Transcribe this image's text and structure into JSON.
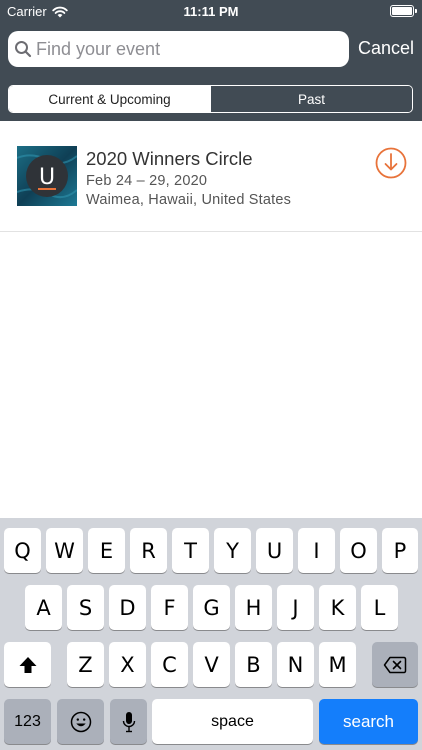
{
  "status_bar": {
    "carrier": "Carrier",
    "time": "11:11 PM"
  },
  "search": {
    "placeholder": "Find your event",
    "value": "",
    "cancel_label": "Cancel"
  },
  "segments": [
    {
      "label": "Current & Upcoming",
      "selected": true
    },
    {
      "label": "Past",
      "selected": false
    }
  ],
  "events": [
    {
      "title": "2020 Winners Circle",
      "dates": "Feb 24 – 29, 2020",
      "location": "Waimea, Hawaii, United States",
      "logo_letter": "U",
      "action_icon": "download-icon"
    }
  ],
  "keyboard": {
    "row1": [
      "Q",
      "W",
      "E",
      "R",
      "T",
      "Y",
      "U",
      "I",
      "O",
      "P"
    ],
    "row2": [
      "A",
      "S",
      "D",
      "F",
      "G",
      "H",
      "J",
      "K",
      "L"
    ],
    "row3": [
      "Z",
      "X",
      "C",
      "V",
      "B",
      "N",
      "M"
    ],
    "numbers_label": "123",
    "space_label": "space",
    "search_label": "search"
  },
  "colors": {
    "header": "#414b54",
    "accent_download": "#e8733a",
    "keyboard_bg": "#d1d4da",
    "search_key": "#147efb"
  }
}
